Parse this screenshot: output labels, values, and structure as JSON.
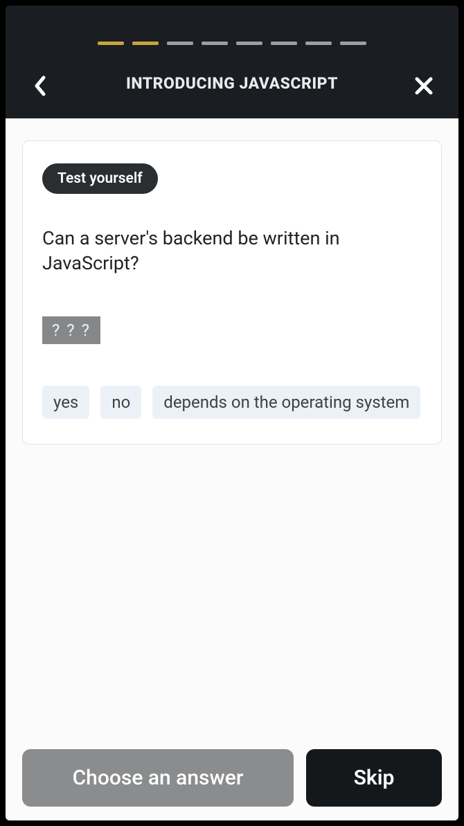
{
  "header": {
    "title": "INTRODUCING JAVASCRIPT",
    "progress": {
      "total": 8,
      "completed": 2
    }
  },
  "card": {
    "badge": "Test yourself",
    "question": "Can a server's backend be written in JavaScript?",
    "slot_placeholder": "? ? ?",
    "options": [
      "yes",
      "no",
      "depends on the operating system"
    ]
  },
  "footer": {
    "primary": "Choose an answer",
    "skip": "Skip"
  }
}
